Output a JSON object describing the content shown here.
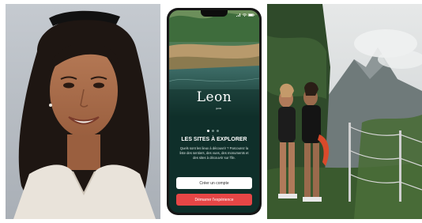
{
  "app": {
    "logo_text": "Leon",
    "logo_subtext": "guide"
  },
  "onboarding": {
    "headline": "LES SITES À EXPLORER",
    "description": "Quels sont les lieux à découvrir ? Parcourez la liste des sentiers, des vues, des monuments et des sites à découvrir sur l'île.",
    "create_account_label": "Créer un compte",
    "start_experience_label": "Démarrer l'expérience",
    "pager_total": 3,
    "pager_active_index": 0
  },
  "colors": {
    "primary_cta": "#e64646",
    "screen_background": "#0f2f2a",
    "secondary_cta": "#ffffff"
  },
  "icons": [
    "signal-icon",
    "wifi-icon",
    "battery-icon"
  ]
}
